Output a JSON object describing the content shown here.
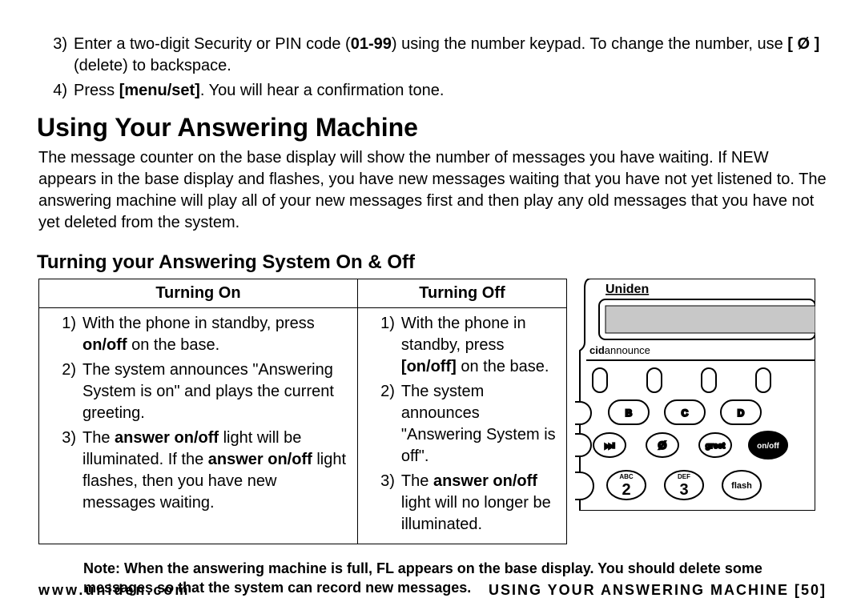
{
  "steps": {
    "s3_a": "Enter a two-digit Security or PIN code (",
    "s3_b": "01-99",
    "s3_c": ") using the number keypad. To change the number, use ",
    "s3_d": "[ Ø ]",
    "s3_e": " (delete) to backspace.",
    "s4_a": "Press ",
    "s4_b": "[menu/set]",
    "s4_c": ". You will hear a confirmation tone."
  },
  "heading1": "Using Your Answering Machine",
  "para1": "The message counter on the base display will show the number of messages you have waiting. If NEW appears in the base display and flashes, you have new messages waiting that you have not yet listened to. The answering machine will play all of your new messages first and then play any old messages that you have not yet deleted from the system.",
  "heading2": "Turning your Answering System On & Off",
  "table": {
    "th_on": "Turning On",
    "th_off": "Turning Off",
    "on": {
      "l1a": "With the phone in standby, press ",
      "l1b": "on/off",
      "l1c": " on the base.",
      "l2": "The system announces \"Answering System is on\" and plays the current greeting.",
      "l3a": "The ",
      "l3b": "answer on/off",
      "l3c": " light will be illuminated. If the ",
      "l3d": "answer on/off",
      "l3e": " light flashes, then you have new messages waiting."
    },
    "off": {
      "l1a": "With the phone in standby, press ",
      "l1b": "[on/off]",
      "l1c": " on the base.",
      "l2": "The system announces \"Answering System is off\".",
      "l3a": "The ",
      "l3b": "answer on/off",
      "l3c": " light will no longer be illuminated."
    }
  },
  "note": "Note: When the answering machine is full, FL appears on the base display. You should delete some messages so that the system can record new messages.",
  "footer": {
    "left": "www.uniden.com",
    "right": "USING YOUR ANSWERING MACHINE [50]"
  },
  "phone": {
    "brand": "Uniden",
    "cid": "cid",
    "announce": "announce",
    "btn_b": "B",
    "btn_c": "C",
    "btn_d": "D",
    "btn_skip": "⏭",
    "btn_del": "Ø",
    "btn_greet": "greet",
    "btn_onoff": "on/off",
    "btn_2_sup": "ABC",
    "btn_2": "2",
    "btn_3_sup": "DEF",
    "btn_3": "3",
    "btn_flash": "flash"
  }
}
